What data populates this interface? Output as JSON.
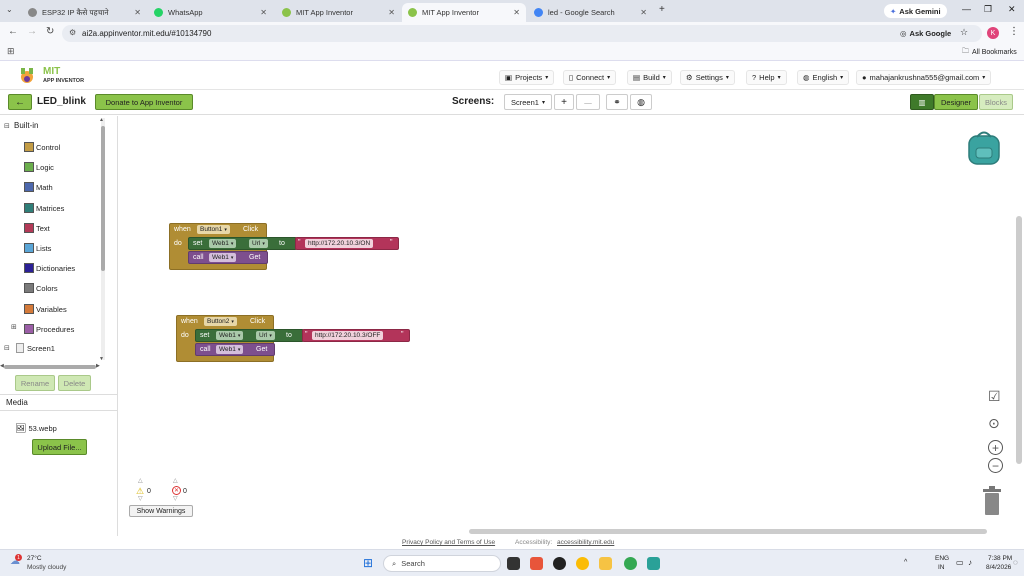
{
  "browser": {
    "tabs": [
      {
        "label": "ESP32 IP कैसे पहचाने",
        "active": false
      },
      {
        "label": "WhatsApp",
        "active": false
      },
      {
        "label": "MIT App Inventor",
        "active": false
      },
      {
        "label": "MIT App Inventor",
        "active": true
      },
      {
        "label": "led - Google Search",
        "active": false
      }
    ],
    "new_tab": "+",
    "ask_gemini": "Ask Gemini",
    "url": "ai2a.appinventor.mit.edu/#10134790",
    "ask_google": "Ask Google",
    "profile_initial": "K",
    "all_bookmarks": "All Bookmarks"
  },
  "app": {
    "logo_line1": "MIT",
    "logo_line2": "APP INVENTOR",
    "menus": [
      "Projects",
      "Connect",
      "Build",
      "Settings",
      "Help",
      "English"
    ],
    "account": "mahajankrushna555@gmail.com"
  },
  "toolbar": {
    "back": "←",
    "project_name": "LED_blink",
    "donate": "Donate to App Inventor",
    "screens_label": "Screens:",
    "screen_select": "Screen1",
    "add": "+",
    "remove": "—",
    "designer": "Designer",
    "blocks": "Blocks"
  },
  "builtin": {
    "header": "Built-in",
    "items": [
      {
        "label": "Control",
        "color": "#c39c45"
      },
      {
        "label": "Logic",
        "color": "#6bae4c"
      },
      {
        "label": "Math",
        "color": "#4d68ad"
      },
      {
        "label": "Matrices",
        "color": "#2f7e78"
      },
      {
        "label": "Text",
        "color": "#b33a57"
      },
      {
        "label": "Lists",
        "color": "#5aa5d6"
      },
      {
        "label": "Dictionaries",
        "color": "#2b2096"
      },
      {
        "label": "Colors",
        "color": "#7a7a7a"
      },
      {
        "label": "Variables",
        "color": "#d47a3a"
      },
      {
        "label": "Procedures",
        "color": "#9b5ea6"
      }
    ],
    "screen1": "Screen1",
    "rename": "Rename",
    "delete": "Delete"
  },
  "media": {
    "header": "Media",
    "file": "53.webp",
    "upload": "Upload File..."
  },
  "blocks": [
    {
      "when": "when",
      "component": "Button1",
      "event": "Click",
      "do": "do",
      "set": "set",
      "web": "Web1",
      "prop": "Url",
      "to": "to",
      "text": "http://172.20.10.3/ON",
      "call": "call",
      "method": "Get"
    },
    {
      "when": "when",
      "component": "Button2",
      "event": "Click",
      "do": "do",
      "set": "set",
      "web": "Web1",
      "prop": "Url",
      "to": "to",
      "text": "http://172.20.10.3/OFF",
      "call": "call",
      "method": "Get"
    }
  ],
  "warnings": {
    "warn_count": "0",
    "error_count": "0",
    "show": "Show Warnings"
  },
  "footer": {
    "privacy": "Privacy Policy and Terms of Use",
    "access_label": "Accessibility:",
    "access_link": "accessibility.mit.edu"
  },
  "taskbar": {
    "temp": "27°C",
    "weather": "Mostly cloudy",
    "weather_badge": "1",
    "search": "Search",
    "lang1": "ENG",
    "lang2": "IN",
    "time": "7:38 PM",
    "date": "8/4/2026"
  }
}
